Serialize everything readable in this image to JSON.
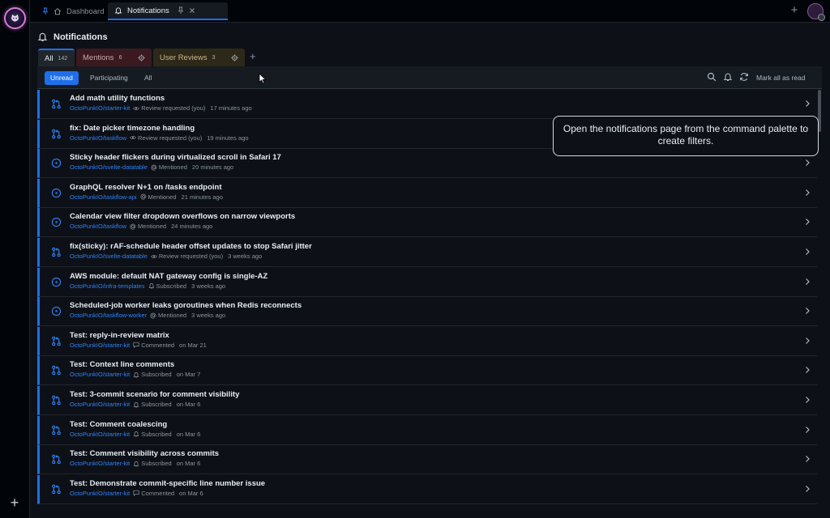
{
  "topbar": {
    "tabs": [
      {
        "label": "Dashboard",
        "icon": "home-icon",
        "pinned": true
      },
      {
        "label": "Notifications",
        "icon": "bell-icon",
        "pinned": true,
        "active": true
      }
    ],
    "new_tab_icon": "plus-icon"
  },
  "page": {
    "title": "Notifications"
  },
  "filter_tabs": [
    {
      "label": "All",
      "count": "142",
      "color": "#21262d"
    },
    {
      "label": "Mentions",
      "count": "6",
      "color": "#3a1a20"
    },
    {
      "label": "User Reviews",
      "count": "3",
      "color": "#2d2818"
    }
  ],
  "toolbar": {
    "filters": [
      "Unread",
      "Participating",
      "All"
    ],
    "selected_filter": "Unread",
    "mark_all_label": "Mark all as read"
  },
  "tooltip": {
    "text": "Open the notifications page from the command palette to create filters."
  },
  "accent_color": "#1f6feb",
  "notifications": [
    {
      "type": "pull-request",
      "title": "Add math utility functions",
      "repo": "OctoPunkIO/starter-kit",
      "reason": "Review requested (you)",
      "reason_icon": "eye-icon",
      "time": "17 minutes ago"
    },
    {
      "type": "pull-request",
      "title": "fix: Date picker timezone handling",
      "repo": "OctoPunkIO/taskflow",
      "reason": "Review requested (you)",
      "reason_icon": "eye-icon",
      "time": "19 minutes ago"
    },
    {
      "type": "issue",
      "title": "Sticky header flickers during virtualized scroll in Safari 17",
      "repo": "OctoPunkIO/svelte-datatable",
      "reason": "Mentioned",
      "reason_icon": "at-icon",
      "time": "20 minutes ago"
    },
    {
      "type": "issue",
      "title": "GraphQL resolver N+1 on /tasks endpoint",
      "repo": "OctoPunkIO/taskflow-api",
      "reason": "Mentioned",
      "reason_icon": "at-icon",
      "time": "21 minutes ago"
    },
    {
      "type": "issue",
      "title": "Calendar view filter dropdown overflows on narrow viewports",
      "repo": "OctoPunkIO/taskflow",
      "reason": "Mentioned",
      "reason_icon": "at-icon",
      "time": "24 minutes ago"
    },
    {
      "type": "pull-request",
      "title": "fix(sticky): rAF-schedule header offset updates to stop Safari jitter",
      "repo": "OctoPunkIO/svelte-datatable",
      "reason": "Review requested (you)",
      "reason_icon": "eye-icon",
      "time": "3 weeks ago"
    },
    {
      "type": "issue",
      "title": "AWS module: default NAT gateway config is single-AZ",
      "repo": "OctoPunkIO/infra-templates",
      "reason": "Subscribed",
      "reason_icon": "bell-icon",
      "time": "3 weeks ago"
    },
    {
      "type": "issue",
      "title": "Scheduled-job worker leaks goroutines when Redis reconnects",
      "repo": "OctoPunkIO/taskflow-worker",
      "reason": "Mentioned",
      "reason_icon": "at-icon",
      "time": "3 weeks ago"
    },
    {
      "type": "pull-request",
      "title": "Test: reply-in-review matrix",
      "repo": "OctoPunkIO/starter-kit",
      "reason": "Commented",
      "reason_icon": "comment-icon",
      "time": "on Mar 21"
    },
    {
      "type": "pull-request",
      "title": "Test: Context line comments",
      "repo": "OctoPunkIO/starter-kit",
      "reason": "Subscribed",
      "reason_icon": "bell-icon",
      "time": "on Mar 7"
    },
    {
      "type": "pull-request",
      "title": "Test: 3-commit scenario for comment visibility",
      "repo": "OctoPunkIO/starter-kit",
      "reason": "Subscribed",
      "reason_icon": "bell-icon",
      "time": "on Mar 6"
    },
    {
      "type": "pull-request",
      "title": "Test: Comment coalescing",
      "repo": "OctoPunkIO/starter-kit",
      "reason": "Subscribed",
      "reason_icon": "bell-icon",
      "time": "on Mar 6"
    },
    {
      "type": "pull-request",
      "title": "Test: Comment visibility across commits",
      "repo": "OctoPunkIO/starter-kit",
      "reason": "Subscribed",
      "reason_icon": "bell-icon",
      "time": "on Mar 6"
    },
    {
      "type": "pull-request",
      "title": "Test: Demonstrate commit-specific line number issue",
      "repo": "OctoPunkIO/starter-kit",
      "reason": "Commented",
      "reason_icon": "comment-icon",
      "time": "on Mar 6"
    }
  ]
}
